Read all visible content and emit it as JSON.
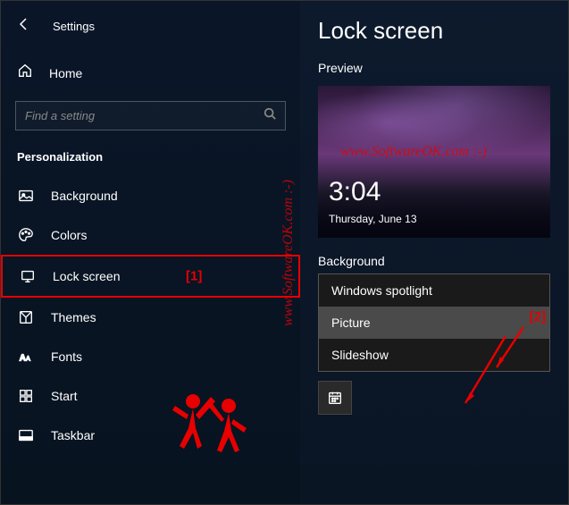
{
  "header": {
    "settings_title": "Settings"
  },
  "home": {
    "label": "Home"
  },
  "search": {
    "placeholder": "Find a setting"
  },
  "category": {
    "title": "Personalization"
  },
  "nav": {
    "items": [
      {
        "label": "Background",
        "icon": "picture-icon"
      },
      {
        "label": "Colors",
        "icon": "palette-icon"
      },
      {
        "label": "Lock screen",
        "icon": "lockscreen-icon"
      },
      {
        "label": "Themes",
        "icon": "themes-icon"
      },
      {
        "label": "Fonts",
        "icon": "fonts-icon"
      },
      {
        "label": "Start",
        "icon": "start-icon"
      },
      {
        "label": "Taskbar",
        "icon": "taskbar-icon"
      }
    ]
  },
  "main": {
    "title": "Lock screen",
    "preview_label": "Preview",
    "preview_time": "3:04",
    "preview_date": "Thursday, June 13",
    "background_label": "Background",
    "dropdown_options": [
      "Windows spotlight",
      "Picture",
      "Slideshow"
    ]
  },
  "annotations": {
    "marker1": "[1]",
    "marker2": "[2]",
    "watermark": "www.SoftwareOK.com :-)"
  }
}
